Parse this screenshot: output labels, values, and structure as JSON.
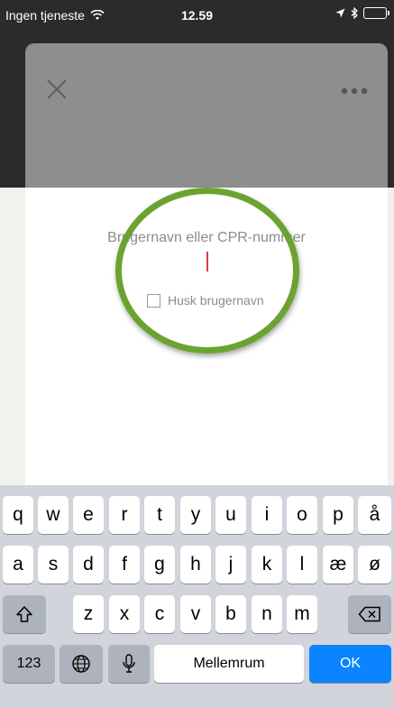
{
  "status_bar": {
    "carrier": "Ingen tjeneste",
    "time": "12.59",
    "icons": [
      "wifi-icon",
      "location-arrow-icon",
      "bluetooth-icon",
      "battery-icon"
    ]
  },
  "modal": {
    "close_icon": "close-icon",
    "more_icon": "more-dots-icon",
    "field_label": "Brugernavn eller CPR-nummer",
    "remember_label": "Husk brugernavn"
  },
  "keyboard": {
    "row1": [
      "q",
      "w",
      "e",
      "r",
      "t",
      "y",
      "u",
      "i",
      "o",
      "p",
      "å"
    ],
    "row2": [
      "a",
      "s",
      "d",
      "f",
      "g",
      "h",
      "j",
      "k",
      "l",
      "æ",
      "ø"
    ],
    "row3": [
      "z",
      "x",
      "c",
      "v",
      "b",
      "n",
      "m"
    ],
    "numbers_label": "123",
    "space_label": "Mellemrum",
    "return_label": "OK",
    "icons": [
      "shift-icon",
      "backspace-icon",
      "globe-icon",
      "microphone-icon"
    ]
  },
  "colors": {
    "highlight_ring": "#6aa32f",
    "caret": "#e03a3e",
    "ok_key": "#0a84ff"
  }
}
